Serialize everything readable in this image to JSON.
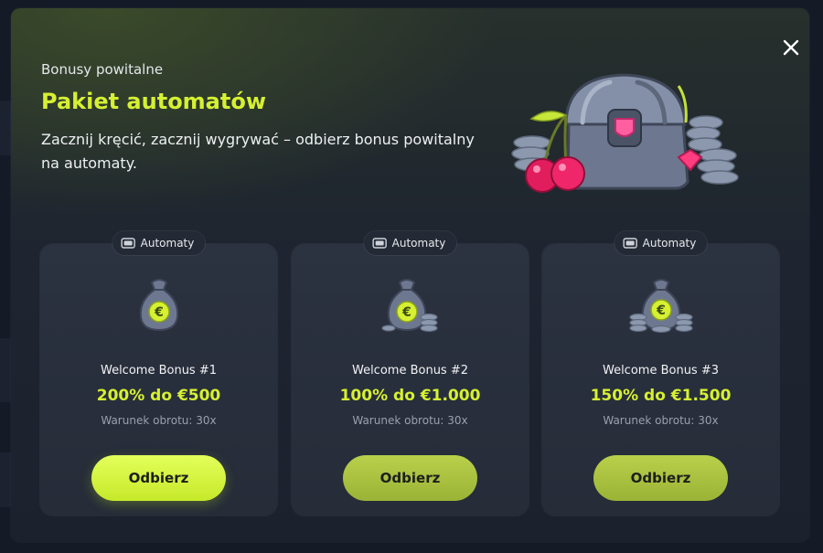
{
  "modal": {
    "eyebrow": "Bonusy powitalne",
    "title": "Pakiet automatów",
    "description": "Zacznij kręcić, zacznij wygrywać – odbierz bonus powitalny na automaty.",
    "close_icon": "close-icon",
    "hero_icon": "treasure-chest-with-cherries-icon"
  },
  "cards": [
    {
      "tag": "Automaty",
      "tag_icon": "slot-machine-icon",
      "name": "Welcome Bonus #1",
      "value": "200% do €500",
      "requirement": "Warunek obrotu: 30x",
      "button": "Odbierz",
      "bag_icon": "euro-money-bag-icon"
    },
    {
      "tag": "Automaty",
      "tag_icon": "slot-machine-icon",
      "name": "Welcome Bonus #2",
      "value": "100% do €1.000",
      "requirement": "Warunek obrotu: 30x",
      "button": "Odbierz",
      "bag_icon": "euro-money-bag-with-coins-icon"
    },
    {
      "tag": "Automaty",
      "tag_icon": "slot-machine-icon",
      "name": "Welcome Bonus #3",
      "value": "150% do €1.500",
      "requirement": "Warunek obrotu: 30x",
      "button": "Odbierz",
      "bag_icon": "euro-money-bag-with-coin-stacks-icon"
    }
  ],
  "colors": {
    "accent": "#d6f032",
    "background": "#1e2530",
    "card": "#2a313e"
  }
}
